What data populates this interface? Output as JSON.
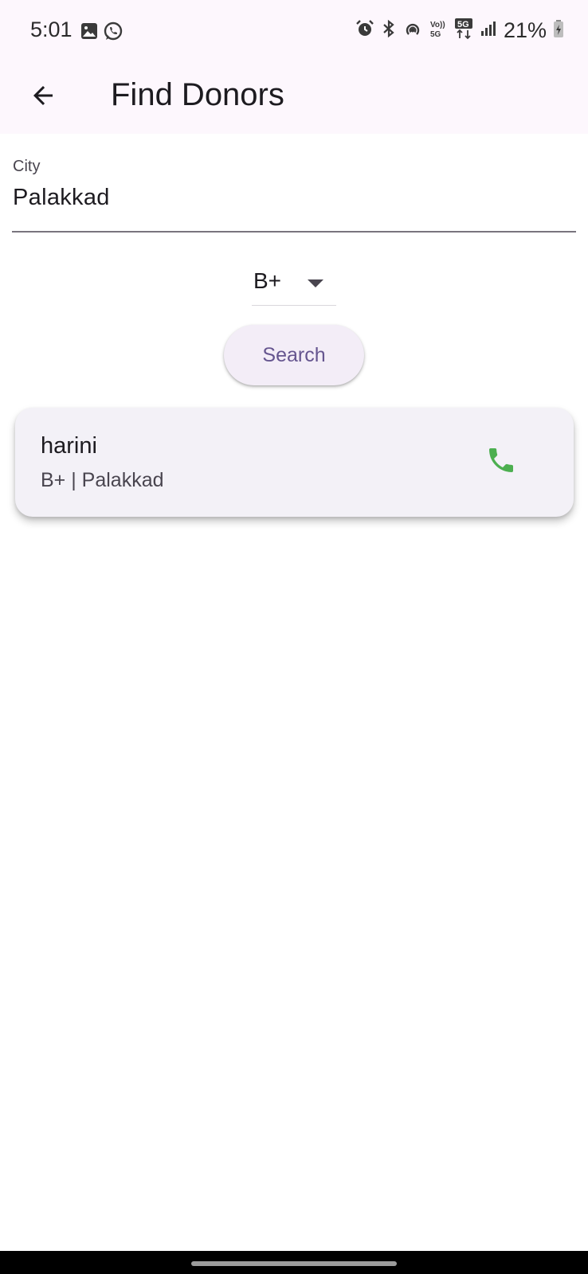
{
  "status_bar": {
    "time": "5:01",
    "left_icons": [
      "gallery-icon",
      "whatsapp-icon"
    ],
    "right_icons": [
      "alarm-icon",
      "bluetooth-icon",
      "hotspot-icon",
      "volte-5g-icon",
      "5g-data-icon",
      "signal-icon",
      "battery-icon"
    ],
    "battery": "21%"
  },
  "app_bar": {
    "title": "Find Donors",
    "back_icon": "arrow-back-icon"
  },
  "form": {
    "city_label": "City",
    "city_value": "Palakkad",
    "blood_group": "B+",
    "search_label": "Search"
  },
  "results": [
    {
      "name": "harini",
      "details": "B+ | Palakkad",
      "action_icon": "phone-icon",
      "action_color": "#4caf50"
    }
  ],
  "colors": {
    "app_bar_bg": "#fdf7fd",
    "button_bg": "#f3edf7",
    "button_text": "#65558f",
    "card_bg": "#f3f1f7",
    "call_icon": "#4caf50"
  }
}
